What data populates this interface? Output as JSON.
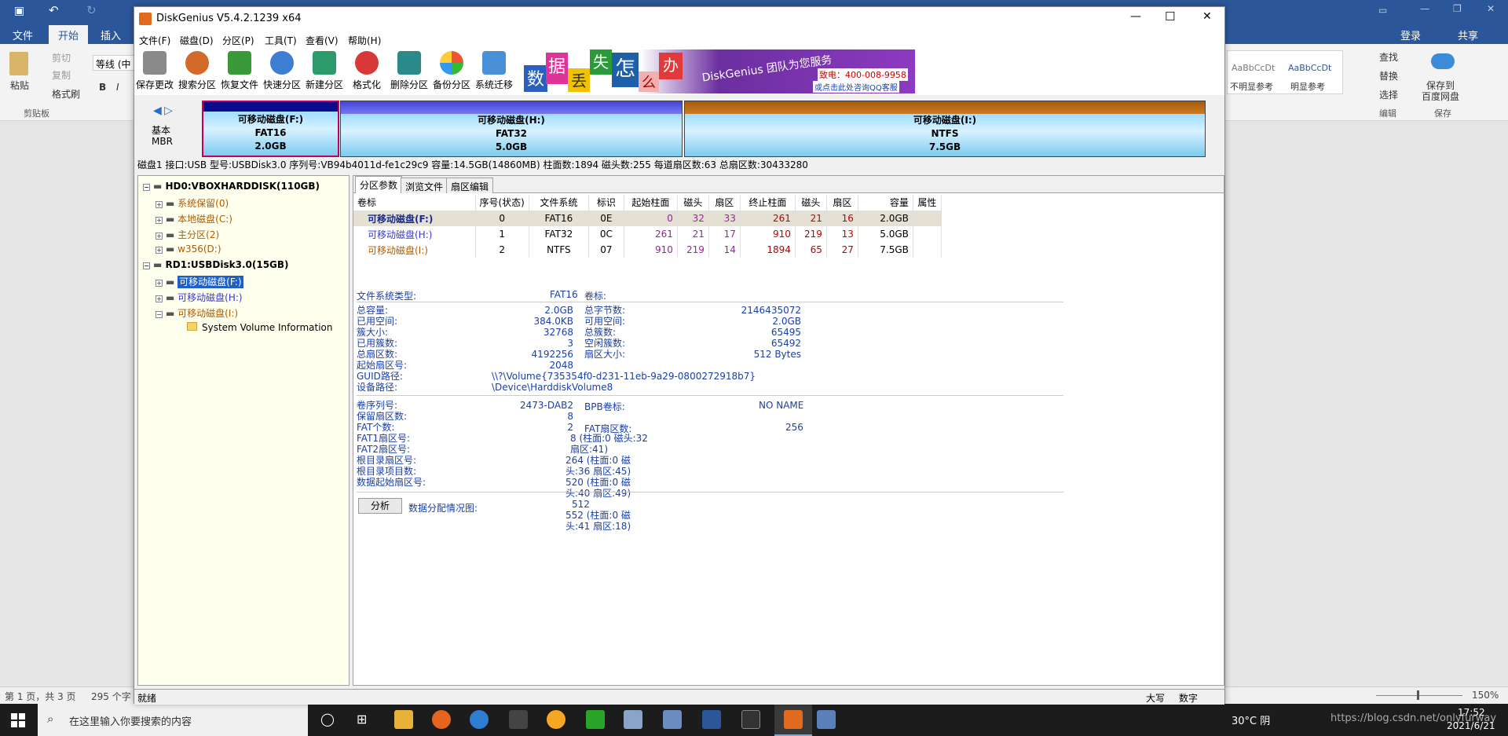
{
  "word": {
    "tabs": [
      "文件",
      "开始",
      "插入"
    ],
    "active_tab": "开始",
    "login": "登录",
    "share": "共享",
    "clipboard": {
      "paste": "粘贴",
      "cut": "剪切",
      "copy": "复制",
      "format_painter": "格式刷",
      "group_label": "剪贴板"
    },
    "font_box": "等线 (中",
    "styles": [
      "AaBbCcDt",
      "AaBbCcDt"
    ],
    "style_names": [
      "不明显参考",
      "明显参考"
    ],
    "editing": {
      "find": "查找",
      "replace": "替换",
      "select": "选择",
      "group_label": "编辑"
    },
    "save_to": {
      "label": "保存到百度网盘",
      "line1": "保存到",
      "line2": "百度网盘",
      "group_label": "保存"
    },
    "status": {
      "page": "第 1 页，共 3 页",
      "words": "295 个字",
      "zoom": "150%"
    }
  },
  "taskbar": {
    "search_placeholder": "在这里输入你要搜索的内容",
    "weather": "30°C 阴",
    "time": "17:52",
    "date": "2021/6/21",
    "watermark": "https://blog.csdn.net/onlyfurway"
  },
  "dg": {
    "title": "DiskGenius V5.4.2.1239 x64",
    "menu": [
      "文件(F)",
      "磁盘(D)",
      "分区(P)",
      "工具(T)",
      "查看(V)",
      "帮助(H)"
    ],
    "toolbar": [
      "保存更改",
      "搜索分区",
      "恢复文件",
      "快速分区",
      "新建分区",
      "格式化",
      "删除分区",
      "备份分区",
      "系统迁移"
    ],
    "banner": {
      "chars": [
        "数",
        "据",
        "丢",
        "失",
        "怎",
        "么",
        "办"
      ],
      "slogan": "DiskGenius 团队为您服务",
      "phone": "致电：400-008-9958",
      "qq": "或点击此处咨询QQ客服"
    },
    "disk_type": {
      "line1": "基本",
      "line2": "MBR"
    },
    "partitions": [
      {
        "name": "可移动磁盘(F:)",
        "fs": "FAT16",
        "size": "2.0GB"
      },
      {
        "name": "可移动磁盘(H:)",
        "fs": "FAT32",
        "size": "5.0GB"
      },
      {
        "name": "可移动磁盘(I:)",
        "fs": "NTFS",
        "size": "7.5GB"
      }
    ],
    "disk_info": "磁盘1 接口:USB  型号:USBDisk3.0  序列号:VB94b4011d-fe1c29c9  容量:14.5GB(14860MB)  柱面数:1894  磁头数:255  每道扇区数:63  总扇区数:30433280",
    "tree": {
      "hd0": "HD0:VBOXHARDDISK(110GB)",
      "hd0_children": [
        "系统保留(0)",
        "本地磁盘(C:)",
        "主分区(2)",
        "w356(D:)"
      ],
      "rd1": "RD1:USBDisk3.0(15GB)",
      "rd1_children": [
        "可移动磁盘(F:)",
        "可移动磁盘(H:)",
        "可移动磁盘(I:)"
      ],
      "svi": "System Volume Information"
    },
    "tabs": [
      "分区参数",
      "浏览文件",
      "扇区编辑"
    ],
    "table": {
      "headers": [
        "卷标",
        "序号(状态)",
        "文件系统",
        "标识",
        "起始柱面",
        "磁头",
        "扇区",
        "终止柱面",
        "磁头",
        "扇区",
        "容量",
        "属性"
      ],
      "rows": [
        [
          "可移动磁盘(F:)",
          "0",
          "FAT16",
          "0E",
          "0",
          "32",
          "33",
          "261",
          "21",
          "16",
          "2.0GB",
          ""
        ],
        [
          "可移动磁盘(H:)",
          "1",
          "FAT32",
          "0C",
          "261",
          "21",
          "17",
          "910",
          "219",
          "13",
          "5.0GB",
          ""
        ],
        [
          "可移动磁盘(I:)",
          "2",
          "NTFS",
          "07",
          "910",
          "219",
          "14",
          "1894",
          "65",
          "27",
          "7.5GB",
          ""
        ]
      ]
    },
    "fsinfo": {
      "fs_type_label": "文件系统类型:",
      "fs_type": "FAT16",
      "vol_label": "卷标:",
      "left_labels": [
        "总容量:",
        "已用空间:",
        "簇大小:",
        "已用簇数:",
        "总扇区数:",
        "起始扇区号:",
        "GUID路径:",
        "设备路径:"
      ],
      "left_values": [
        "2.0GB",
        "384.0KB",
        "32768",
        "3",
        "4192256",
        "2048"
      ],
      "guid": "\\\\?\\Volume{735354f0-d231-11eb-9a29-0800272918b7}",
      "device": "\\Device\\HarddiskVolume8",
      "right_labels": [
        "总字节数:",
        "可用空间:",
        "总簇数:",
        "空闲簇数:",
        "扇区大小:"
      ],
      "right_values": [
        "2146435072",
        "2.0GB",
        "65495",
        "65492",
        "512 Bytes"
      ],
      "s2_left_labels": [
        "卷序列号:",
        "保留扇区数:",
        "FAT个数:",
        "FAT1扇区号:",
        "FAT2扇区号:",
        "根目录扇区号:",
        "根目录项目数:",
        "数据起始扇区号:"
      ],
      "s2_left_values": [
        "2473-DAB2",
        "8",
        "2",
        "8 (柱面:0 磁头:32 扇区:41)",
        "264 (柱面:0 磁头:36 扇区:45)",
        "520 (柱面:0 磁头:40 扇区:49)",
        "512",
        "552 (柱面:0 磁头:41 扇区:18)"
      ],
      "bpb_label": "BPB卷标:",
      "bpb_value": "NO NAME",
      "fat_sectors_label": "FAT扇区数:",
      "fat_sectors_value": "256",
      "analyze_button": "分析",
      "data_alloc": "数据分配情况图:"
    },
    "status": {
      "ready": "就绪",
      "caps": "大写",
      "num": "数字"
    }
  }
}
